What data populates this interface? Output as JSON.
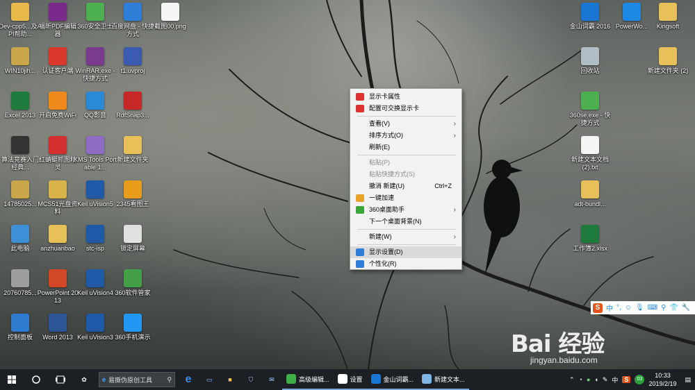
{
  "desktop": {
    "icons": [
      {
        "label": "Dev-cpp5...及API帮助...",
        "icon": "folder-icon",
        "color": "#e8b84a"
      },
      {
        "label": "福昕PDF编辑器",
        "icon": "pdf-editor-icon",
        "color": "#7b2a8c"
      },
      {
        "label": "360安全卫士",
        "icon": "360-safe-icon",
        "color": "#4caf50"
      },
      {
        "label": "百度网盘 - 快捷方式",
        "icon": "baidu-netdisk-icon",
        "color": "#2f7fd8"
      },
      {
        "label": "截图00.png",
        "icon": "image-file-icon",
        "color": "#f5f5f5"
      },
      {
        "label": "WIN10jih...",
        "icon": "archive-icon",
        "color": "#c9a64a"
      },
      {
        "label": "认证客户端",
        "icon": "auth-client-icon",
        "color": "#d9382b"
      },
      {
        "label": "WinRAR.exe - 快捷方式",
        "icon": "winrar-icon",
        "color": "#7a3b8f"
      },
      {
        "label": "t1.uvproj",
        "icon": "keil-project-icon",
        "color": "#3a5bb0"
      },
      {
        "label": "Excel 2013",
        "icon": "excel-icon",
        "color": "#1f7a3e"
      },
      {
        "label": "开启免费WiFi",
        "icon": "wifi-icon",
        "color": "#f08a1c"
      },
      {
        "label": "QQ影音",
        "icon": "qq-player-icon",
        "color": "#2a8ad8"
      },
      {
        "label": "RdfSnap3...",
        "icon": "rdfsnap-icon",
        "color": "#c62828"
      },
      {
        "label": "算法竞赛入门经典...",
        "icon": "book-icon",
        "color": "#333333"
      },
      {
        "label": "红蜻蜓抓图精灵",
        "icon": "dragonfly-icon",
        "color": "#d32f2f"
      },
      {
        "label": "KMS Tools Portable 1...",
        "icon": "kms-icon",
        "color": "#8e6cc4"
      },
      {
        "label": "新建文件夹",
        "icon": "folder-icon",
        "color": "#e8c05a"
      },
      {
        "label": "14785025...",
        "icon": "archive-icon",
        "color": "#c9a64a"
      },
      {
        "label": "MCS51光盘资料",
        "icon": "folder-icon",
        "color": "#d9b34a"
      },
      {
        "label": "Keil uVision5",
        "icon": "keil-icon",
        "color": "#1e5aa8"
      },
      {
        "label": "2345看图王",
        "icon": "image-viewer-icon",
        "color": "#e89c1c"
      },
      {
        "label": "此电脑",
        "icon": "computer-icon",
        "color": "#3d8fd6"
      },
      {
        "label": "anzhuanbao",
        "icon": "folder-icon",
        "color": "#e8c05a"
      },
      {
        "label": "stc-isp",
        "icon": "keil-icon",
        "color": "#1e5aa8"
      },
      {
        "label": "锁定屏幕",
        "icon": "file-icon",
        "color": "#e0e0e0"
      },
      {
        "label": "20760785...",
        "icon": "file-icon",
        "color": "#9e9e9e"
      },
      {
        "label": "PowerPoint 2013",
        "icon": "powerpoint-icon",
        "color": "#d24726"
      },
      {
        "label": "Keil uVision4",
        "icon": "keil-icon",
        "color": "#1e5aa8"
      },
      {
        "label": "360软件管家",
        "icon": "360-software-icon",
        "color": "#43a047"
      },
      {
        "label": "控制面板",
        "icon": "control-panel-icon",
        "color": "#2e7bcf"
      },
      {
        "label": "Word 2013",
        "icon": "word-icon",
        "color": "#2b5797"
      },
      {
        "label": "Keil uVision3",
        "icon": "keil-icon",
        "color": "#1e5aa8"
      },
      {
        "label": "360手机演示",
        "icon": "360-phone-icon",
        "color": "#2196f3"
      },
      {
        "label": "金山词霸 2016",
        "icon": "kingsoft-dict-icon",
        "color": "#1976d2"
      },
      {
        "label": "PowerWo...",
        "icon": "powerwo-icon",
        "color": "#1e88e5"
      },
      {
        "label": "Kingsoft",
        "icon": "folder-icon",
        "color": "#e8c05a"
      },
      {
        "label": "回收站",
        "icon": "recycle-bin-icon",
        "color": "#b0bec5"
      },
      {
        "label": "新建文件夹 (2)",
        "icon": "folder-icon",
        "color": "#e8c05a"
      },
      {
        "label": "360se.exe - 快捷方式",
        "icon": "360-browser-icon",
        "color": "#4caf50"
      },
      {
        "label": "新建文本文档 (2).txt",
        "icon": "text-file-icon",
        "color": "#f5f5f5"
      },
      {
        "label": "adt-bundl...",
        "icon": "folder-icon",
        "color": "#e8c05a"
      },
      {
        "label": "工作簿2.xlsx",
        "icon": "excel-icon",
        "color": "#1f7a3e"
      }
    ]
  },
  "context_menu": {
    "items": [
      {
        "label": "显示卡属性",
        "icon": "graphics-properties-icon",
        "type": "item"
      },
      {
        "label": "配置可交换显示卡",
        "icon": "switchable-graphics-icon",
        "type": "item"
      },
      {
        "type": "sep"
      },
      {
        "label": "查看(V)",
        "submenu": true,
        "type": "item"
      },
      {
        "label": "排序方式(O)",
        "submenu": true,
        "type": "item"
      },
      {
        "label": "刷新(E)",
        "type": "item"
      },
      {
        "type": "sep"
      },
      {
        "label": "粘贴(P)",
        "disabled": true,
        "type": "item"
      },
      {
        "label": "粘贴快捷方式(S)",
        "disabled": true,
        "type": "item"
      },
      {
        "label": "撤消 新建(U)",
        "shortcut": "Ctrl+Z",
        "type": "item"
      },
      {
        "label": "一键加速",
        "icon": "speedup-icon",
        "type": "item"
      },
      {
        "label": "360桌面助手",
        "icon": "360-desktop-icon",
        "submenu": true,
        "type": "item"
      },
      {
        "label": "下一个桌面背景(N)",
        "type": "item"
      },
      {
        "type": "sep"
      },
      {
        "label": "新建(W)",
        "submenu": true,
        "type": "item"
      },
      {
        "type": "sep"
      },
      {
        "label": "显示设置(D)",
        "icon": "display-settings-icon",
        "highlighted": true,
        "type": "item"
      },
      {
        "label": "个性化(R)",
        "icon": "personalize-icon",
        "type": "item"
      }
    ]
  },
  "ime": {
    "logo": "S",
    "mode": "中"
  },
  "watermark": {
    "text": "Bai 经验",
    "url": "jingyan.baidu.com"
  },
  "taskbar": {
    "search_text": "易撕伪原创工具",
    "apps": [
      {
        "label": "高级编辑...",
        "icon": "editor-app-icon"
      },
      {
        "label": "设置",
        "icon": "settings-gear-icon"
      },
      {
        "label": "金山词霸...",
        "icon": "kingsoft-dict-icon"
      },
      {
        "label": "新建文本...",
        "icon": "notepad-icon"
      }
    ],
    "tray_input": "中",
    "badge": "S",
    "time": "10:33",
    "date": "2019/2/19"
  }
}
